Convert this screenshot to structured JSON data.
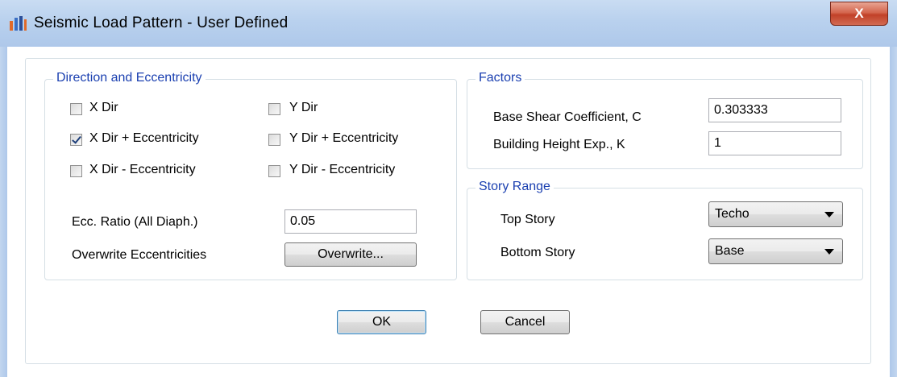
{
  "window": {
    "title": "Seismic Load Pattern - User Defined",
    "close_label": "X"
  },
  "direction": {
    "title": "Direction and Eccentricity",
    "options": [
      {
        "label": "X Dir",
        "checked": false
      },
      {
        "label": "Y Dir",
        "checked": false
      },
      {
        "label": "X Dir + Eccentricity",
        "checked": true
      },
      {
        "label": "Y Dir + Eccentricity",
        "checked": false
      },
      {
        "label": "X Dir - Eccentricity",
        "checked": false
      },
      {
        "label": "Y Dir - Eccentricity",
        "checked": false
      }
    ],
    "ecc_ratio_label": "Ecc. Ratio (All Diaph.)",
    "ecc_ratio_value": "0.05",
    "overwrite_label": "Overwrite Eccentricities",
    "overwrite_button": "Overwrite..."
  },
  "factors": {
    "title": "Factors",
    "base_shear_label": "Base Shear Coefficient, C",
    "base_shear_value": "0.303333",
    "height_exp_label": "Building Height Exp., K",
    "height_exp_value": "1"
  },
  "story_range": {
    "title": "Story Range",
    "top_label": "Top Story",
    "top_value": "Techo",
    "bottom_label": "Bottom Story",
    "bottom_value": "Base"
  },
  "buttons": {
    "ok": "OK",
    "cancel": "Cancel"
  }
}
